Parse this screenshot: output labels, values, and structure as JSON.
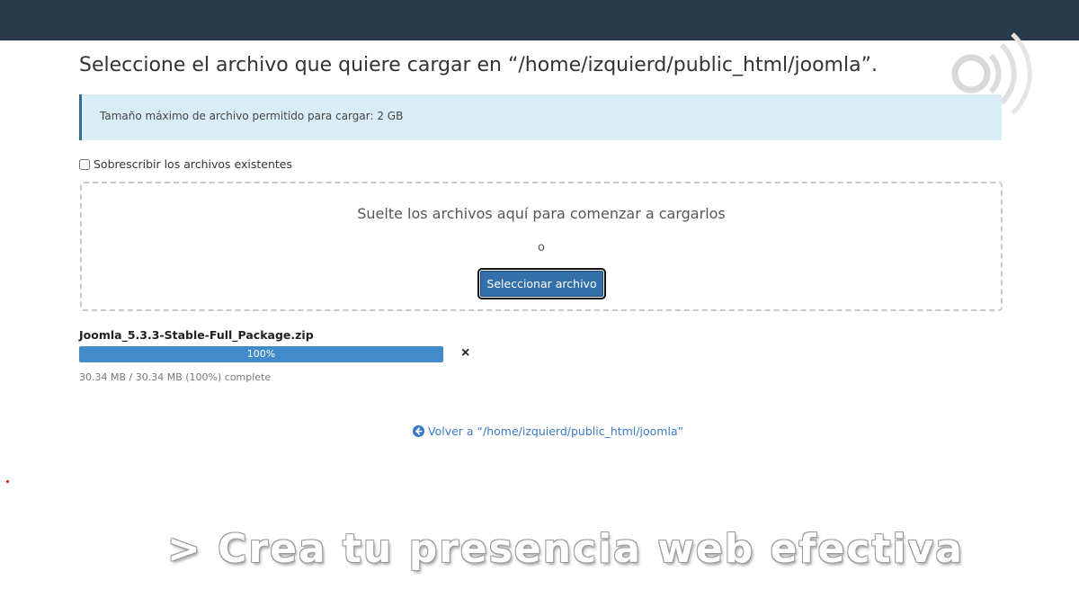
{
  "header": {
    "title": "Seleccione el archivo que quiere cargar en “/home/izquierd/public_html/joomla”."
  },
  "info": {
    "max_size_text": "Tamaño máximo de archivo permitido para cargar: 2 GB"
  },
  "options": {
    "overwrite_label": "Sobrescribir los archivos existentes",
    "overwrite_checked": false
  },
  "dropzone": {
    "instruction": "Suelte los archivos aquí para comenzar a cargarlos",
    "or_text": "o",
    "select_button_label": "Seleccionar archivo"
  },
  "upload": {
    "file_name": "Joomla_5.3.3-Stable-Full_Package.zip",
    "progress_percent": 100,
    "progress_label": "100%",
    "remove_symbol": "×",
    "status": "30.34 MB / 30.34 MB (100%) complete"
  },
  "footer": {
    "back_link_label": "Volver a “/home/izquierd/public_html/joomla”"
  },
  "overlay": {
    "banner_text": "> Crea tu presencia web efectiva"
  },
  "colors": {
    "topbar": "#293a4a",
    "info_bg": "#d9edf7",
    "accent": "#336fa8",
    "progress": "#428bca",
    "link": "#3a7bc8"
  },
  "icons": {
    "back": "arrow-circle-left-icon",
    "remove": "close-icon",
    "watermark": "broadcast-watermark-icon"
  }
}
